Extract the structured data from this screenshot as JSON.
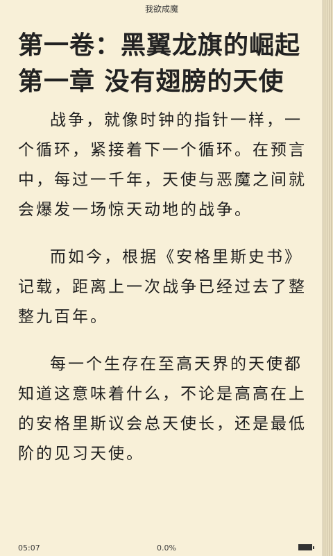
{
  "header": {
    "book_title": "我欲成魔"
  },
  "chapter": {
    "title": "第一卷：黑翼龙旗的崛起 第一章 没有翅膀的天使"
  },
  "paragraphs": [
    "战争，就像时钟的指针一样，一个循环，紧接着下一个循环。在预言中，每过一千年，天使与恶魔之间就会爆发一场惊天动地的战争。",
    "而如今，根据《安格里斯史书》记载，距离上一次战争已经过去了整整九百年。",
    "每一个生存在至高天界的天使都知道这意味着什么，不论是高高在上的安格里斯议会总天使长，还是最低阶的见习天使。"
  ],
  "footer": {
    "time": "05:07",
    "progress": "0.0%",
    "battery_icon": "battery-icon",
    "battery_level": 1.0
  }
}
